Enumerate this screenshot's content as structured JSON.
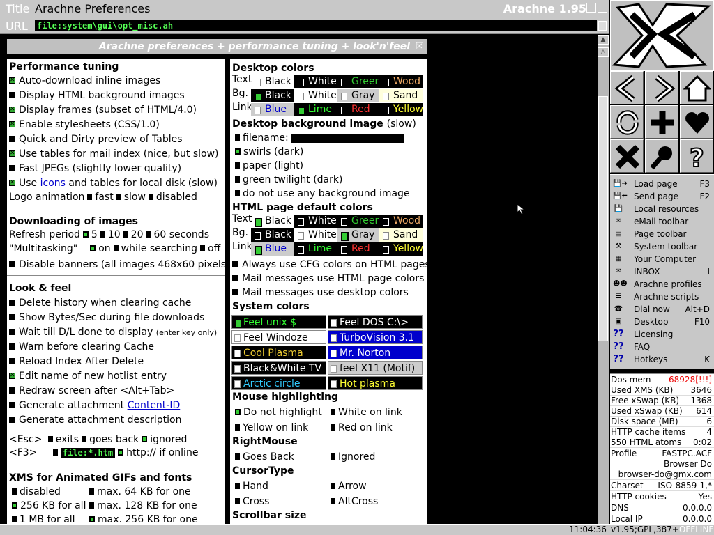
{
  "window": {
    "title_label": "Title",
    "title": "Arachne Preferences",
    "version": "Arachne 1.95"
  },
  "url": {
    "label": "URL",
    "value": "file:system\\gui\\opt_misc.ah"
  },
  "page": {
    "title": "Arachne preferences + performance tuning + look'n'feel"
  },
  "perf": {
    "title": "Performance tuning",
    "items": [
      "Auto-download inline images",
      "Display HTML background images",
      "Display frames (subset of HTML/4.0)",
      "Enable stylesheets (CSS/1.0)",
      "Quick and Dirty preview of Tables",
      "Use tables for mail index (nice, but slow)",
      "Fast JPEGs (slightly lower quality)"
    ],
    "icons_pre": "Use",
    "icons_link": "icons",
    "icons_post": "and tables for local disk (slow)",
    "logo_label": "Logo animation",
    "logo_fast": "fast",
    "logo_slow": "slow",
    "logo_disabled": "disabled"
  },
  "dl": {
    "title": "Downloading of images",
    "refresh_label": "Refresh period",
    "r5": "5",
    "r10": "10",
    "r20": "20",
    "r60": "60 seconds",
    "multi_label": "\"Multitasking\"",
    "m_on": "on",
    "m_search": "while searching",
    "m_off": "off",
    "banners": "Disable banners (all images 468x60 pixels)"
  },
  "look": {
    "title": "Look & feel",
    "items": [
      "Delete history when clearing cache",
      "Show Bytes/Sec during file downloads",
      "Wait till D/L done to display"
    ],
    "wait_small": "(enter key only)",
    "items2": [
      "Warn before clearing Cache",
      "Reload Index After Delete",
      "Edit name of new hotlist entry",
      "Redraw screen after <Alt+Tab>"
    ],
    "attach_pre": "Generate attachment",
    "attach_link": "Content-ID",
    "attach_desc": "Generate attachment description",
    "esc": "<Esc>",
    "esc_exits": "exits",
    "esc_back": "goes back",
    "esc_ignored": "ignored",
    "f3": "<F3>",
    "f3_file": "file:*.htm",
    "f3_http": "http:// if online"
  },
  "xms": {
    "title": "XMS for Animated GIFs and fonts",
    "disabled": "disabled",
    "max64": "max. 64 KB for one",
    "kb256all": "256 KB for all",
    "max128": "max. 128 KB for one",
    "mb1all": "1 MB for all",
    "max256": "max. 256 KB for one"
  },
  "desk": {
    "title": "Desktop colors",
    "text": "Text",
    "bg": "Bg.",
    "link": "Link",
    "text_opts": [
      "Black",
      "White",
      "Green",
      "Wood"
    ],
    "bg_opts": [
      "Black",
      "White",
      "Gray",
      "Sand"
    ],
    "link_opts": [
      "Blue",
      "Lime",
      "Red",
      "Yellow"
    ]
  },
  "bgimg": {
    "title": "Desktop background image",
    "slow": "(slow)",
    "filename": "filename:",
    "opts": [
      "swirls (dark)",
      "paper (light)",
      "green twilight (dark)",
      "do not use any background image"
    ]
  },
  "html": {
    "title": "HTML page default colors",
    "text": "Text",
    "bg": "Bg.",
    "link": "Link",
    "text_opts": [
      "Black",
      "White",
      "Green",
      "Wood"
    ],
    "bg_opts": [
      "Black",
      "White",
      "Gray",
      "Sand"
    ],
    "link_opts": [
      "Blue",
      "Lime",
      "Red",
      "Yellow"
    ],
    "checks": [
      "Always use CFG colors on HTML pages",
      "Mail messages use HTML page colors",
      "Mail messages use desktop colors"
    ]
  },
  "sys": {
    "title": "System colors",
    "opts": [
      "Feel unix $",
      "Feel DOS C:\\>",
      "Feel Windoze",
      "TurboVision 3.1",
      "Cool Plasma",
      "Mr. Norton",
      "Black&White TV",
      "feel X11 (Motif)",
      "Arctic circle",
      "Hot plasma"
    ]
  },
  "mouse": {
    "title": "Mouse highlighting",
    "opts": [
      "Do not highlight",
      "White on link",
      "Yellow on link",
      "Red on link"
    ]
  },
  "rmouse": {
    "title": "RightMouse",
    "back": "Goes Back",
    "ignored": "Ignored"
  },
  "cursor": {
    "title": "CursorType",
    "opts": [
      "Hand",
      "Arrow",
      "Cross",
      "AltCross"
    ]
  },
  "scroll": {
    "title": "Scrollbar size"
  },
  "menu": [
    {
      "label": "Load page",
      "key": "F3",
      "icon": "load-page-icon"
    },
    {
      "label": "Send page",
      "key": "F2",
      "icon": "send-page-icon"
    },
    {
      "label": "Local resources",
      "key": "",
      "icon": "disk-icon"
    },
    {
      "label": "eMail toolbar",
      "key": "",
      "icon": "envelope-icon"
    },
    {
      "label": "Page toolbar",
      "key": "",
      "icon": "page-icon"
    },
    {
      "label": "System toolbar",
      "key": "",
      "icon": "hammer-icon"
    },
    {
      "label": "Your Computer",
      "key": "",
      "icon": "computer-icon"
    },
    {
      "label": "INBOX",
      "key": "I",
      "icon": "inbox-icon"
    },
    {
      "label": "Arachne profiles",
      "key": "",
      "icon": "profiles-icon"
    },
    {
      "label": "Arachne scripts",
      "key": "",
      "icon": "scripts-icon"
    },
    {
      "label": "Dial now",
      "key": "Alt+D",
      "icon": "phone-icon"
    },
    {
      "label": "Desktop",
      "key": "F10",
      "icon": "desktop-icon"
    },
    {
      "label": "Licensing",
      "key": "",
      "icon": "question-icon"
    },
    {
      "label": "FAQ",
      "key": "",
      "icon": "question-icon"
    },
    {
      "label": "Hotkeys",
      "key": "K",
      "icon": "question-icon"
    }
  ],
  "stats": [
    {
      "l": "Dos mem",
      "r": "68928[!!!]",
      "red": true
    },
    {
      "l": "Used XMS (KB)",
      "r": "3646"
    },
    {
      "l": "Free xSwap (KB)",
      "r": "1368"
    },
    {
      "l": "Used xSwap (KB)",
      "r": "614"
    },
    {
      "l": "Disk space (MB)",
      "r": "6"
    },
    {
      "l": "HTTP cache items",
      "r": "4"
    },
    {
      "l": "550 HTML atoms",
      "r": "0:02"
    },
    {
      "l": "Profile",
      "r": "FASTPC.ACF"
    },
    {
      "l": "",
      "r": "Browser Do"
    },
    {
      "l": "",
      "r": "browser-do@gmx.com"
    },
    {
      "l": "Charset",
      "r": "ISO-8859-1,*"
    },
    {
      "l": "HTTP cookies",
      "r": "Yes"
    },
    {
      "l": "DNS",
      "r": "0.0.0.0"
    },
    {
      "l": "Local IP",
      "r": "0.0.0.0"
    }
  ],
  "status": {
    "time": "11:04:36",
    "version": "v1.95;GPL,387+",
    "offline": "OFFLINE"
  },
  "colors": {
    "green": "#33cc33",
    "panel": "#c8c8c8",
    "link": "#0000cc"
  }
}
